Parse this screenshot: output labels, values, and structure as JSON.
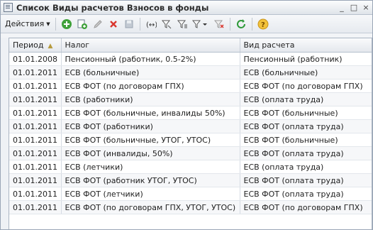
{
  "window": {
    "title": "Список Виды расчетов Взносов в фонды",
    "buttons": [
      "_",
      "□",
      "×"
    ]
  },
  "toolbar": {
    "actions_label": "Действия",
    "icons": [
      "add-icon",
      "copy-icon",
      "edit-icon",
      "delete-icon",
      "save-icon",
      "hierarchy-icon",
      "filter-icon",
      "filter-list-icon",
      "filter-clear-icon",
      "refresh-icon",
      "help-icon"
    ]
  },
  "table": {
    "columns": [
      "Период",
      "Налог",
      "Вид расчета"
    ],
    "rows": [
      [
        "01.01.2008",
        "Пенсионный (работник, 0.5-2%)",
        "Пенсионный (работник)"
      ],
      [
        "01.01.2011",
        "ЕСВ (больничные)",
        "ЕСВ (больничные)"
      ],
      [
        "01.01.2011",
        "ЕСВ ФОТ (по договорам ГПХ)",
        "ЕСВ ФОТ (по договорам ГПХ)"
      ],
      [
        "01.01.2011",
        "ЕСВ (работники)",
        "ЕСВ (оплата труда)"
      ],
      [
        "01.01.2011",
        "ЕСВ ФОТ (больничные, инвалиды 50%)",
        "ЕСВ ФОТ (больничные)"
      ],
      [
        "01.01.2011",
        "ЕСВ ФОТ (работники)",
        "ЕСВ ФОТ (оплата труда)"
      ],
      [
        "01.01.2011",
        "ЕСВ ФОТ (больничные, УТОГ, УТОС)",
        "ЕСВ ФОТ (больничные)"
      ],
      [
        "01.01.2011",
        "ЕСВ ФОТ (инвалиды, 50%)",
        "ЕСВ ФОТ (оплата труда)"
      ],
      [
        "01.01.2011",
        "ЕСВ (летчики)",
        "ЕСВ (оплата труда)"
      ],
      [
        "01.01.2011",
        "ЕСВ ФОТ (работник УТОГ, УТОС)",
        "ЕСВ ФОТ (оплата труда)"
      ],
      [
        "01.01.2011",
        "ЕСВ ФОТ (летчики)",
        "ЕСВ ФОТ (оплата труда)"
      ],
      [
        "01.01.2011",
        "ЕСВ ФОТ (по договорам ГПХ, УТОГ, УТОС)",
        "ЕСВ ФОТ (по договорам ГПХ)"
      ]
    ]
  }
}
